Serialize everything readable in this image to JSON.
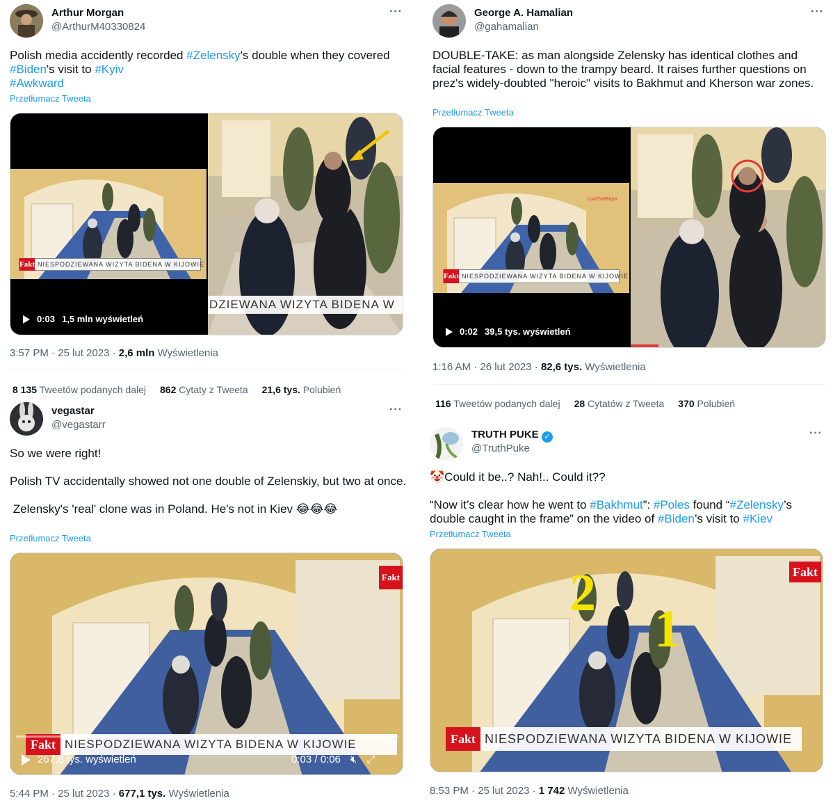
{
  "tweets": [
    {
      "name": "Arthur Morgan",
      "handle": "@ArthurM40330824",
      "text_parts": [
        "Polish media accidently recorded ",
        "#Zelensky",
        "'s double when they covered",
        "#Biden",
        "'s visit to ",
        "#Kyiv",
        "#Awkward"
      ],
      "translate": "Przetłumacz Tweeta",
      "video": {
        "time": "0:03",
        "views": "1,5 mln wyświetleń",
        "caption": "NIESPODZIEWANA WIZYTA BIDENA W KIJOWIE",
        "logo": "Fakt",
        "zoom_caption": "DZIEWANA WIZYTA BIDENA W"
      },
      "timestamp": "3:57 PM · 25 lut 2023 · ",
      "views_count": "2,6 mln",
      "views_label": " Wyświetlenia",
      "stats": [
        {
          "count": "8 135",
          "label": " Tweetów podanych dalej"
        },
        {
          "count": "862",
          "label": " Cytaty z Tweeta"
        },
        {
          "count": "21,6 tys.",
          "label": " Polubień"
        }
      ]
    },
    {
      "name": "George A. Hamalian",
      "handle": "@gahamalian",
      "text": "DOUBLE-TAKE: as man alongside Zelensky has identical clothes and facial features - down to the trampy beard. It raises further questions on prez's widely-doubted \"heroic\" visits to Bakhmut and Kherson war zones.",
      "translate": "Przetłumacz Tweeta",
      "video": {
        "time": "0:02",
        "views": "39,5 tys. wyświetleń",
        "caption": "NIESPODZIEWANA WIZYTA BIDENA W KIJOWIE",
        "logo": "Fakt",
        "watermark": "LordTrelRepo"
      },
      "timestamp": "1:16 AM · 26 lut 2023 · ",
      "views_count": "82,6 tys.",
      "views_label": " Wyświetlenia",
      "stats": [
        {
          "count": "116",
          "label": " Tweetów podanych dalej"
        },
        {
          "count": "28",
          "label": " Cytatów z Tweeta"
        },
        {
          "count": "370",
          "label": " Polubień"
        }
      ]
    },
    {
      "name": "vegastar",
      "handle": "@vegastarr",
      "line1": "So we were right!",
      "line2": "Polish TV accidentally showed not one double of Zelenskiy, but two at once.",
      "line3": " Zelensky's 'real' clone was in Poland. He's not in Kiev 😂😂😂",
      "translate": "Przetłumacz Tweeta",
      "video": {
        "views": "267,8 tys. wyświetleń",
        "time": "0:03 / 0:06",
        "caption": "NIESPODZIEWANA WIZYTA BIDENA W KIJOWIE",
        "logo": "Fakt"
      },
      "timestamp": "5:44 PM · 25 lut 2023 · ",
      "views_count": "677,1 tys.",
      "views_label": " Wyświetlenia"
    },
    {
      "name": "TRUTH PUKE",
      "handle": "@TruthPuke",
      "line1": "🤡Could it be..? Nah!.. Could it??",
      "text_parts": [
        "“Now it’s clear how he went to ",
        "#Bakhmut",
        "”: ",
        "#Poles",
        " found “",
        "#Zelensky",
        "’s double caught in the frame” on the video of ",
        "#Biden",
        "’s visit to ",
        "#Kiev"
      ],
      "translate": "Przetłumacz Tweeta",
      "video": {
        "caption": "NIESPODZIEWANA WIZYTA BIDENA W KIJOWIE",
        "logo": "Fakt",
        "mark1": "2",
        "mark2": "1"
      },
      "timestamp": "8:53 PM · 25 lut 2023 · ",
      "views_count": "1 742",
      "views_label": " Wyświetlenia"
    }
  ],
  "colors": {
    "link": "#1d9bf0",
    "text": "#0f1419",
    "muted": "#536471"
  }
}
